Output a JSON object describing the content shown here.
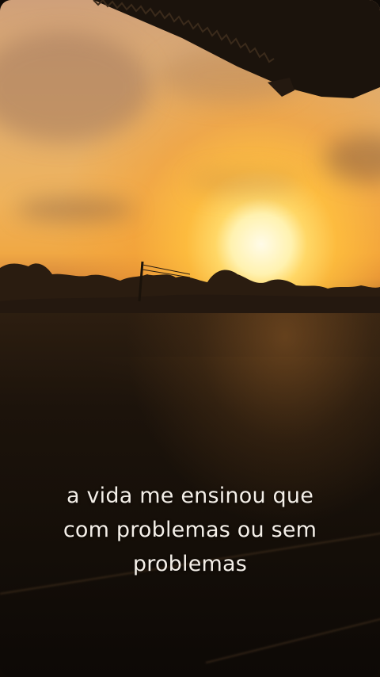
{
  "caption": {
    "lines": [
      "a vida me ensinou que",
      "com problemas ou sem",
      "problemas"
    ]
  },
  "scene": {
    "description_icon": "sunset-photo",
    "colors": {
      "sun": "#fff6d0",
      "sky_glow": "#f0a844",
      "silhouette": "#1e150c",
      "caption_text": "#f4efe8"
    }
  }
}
